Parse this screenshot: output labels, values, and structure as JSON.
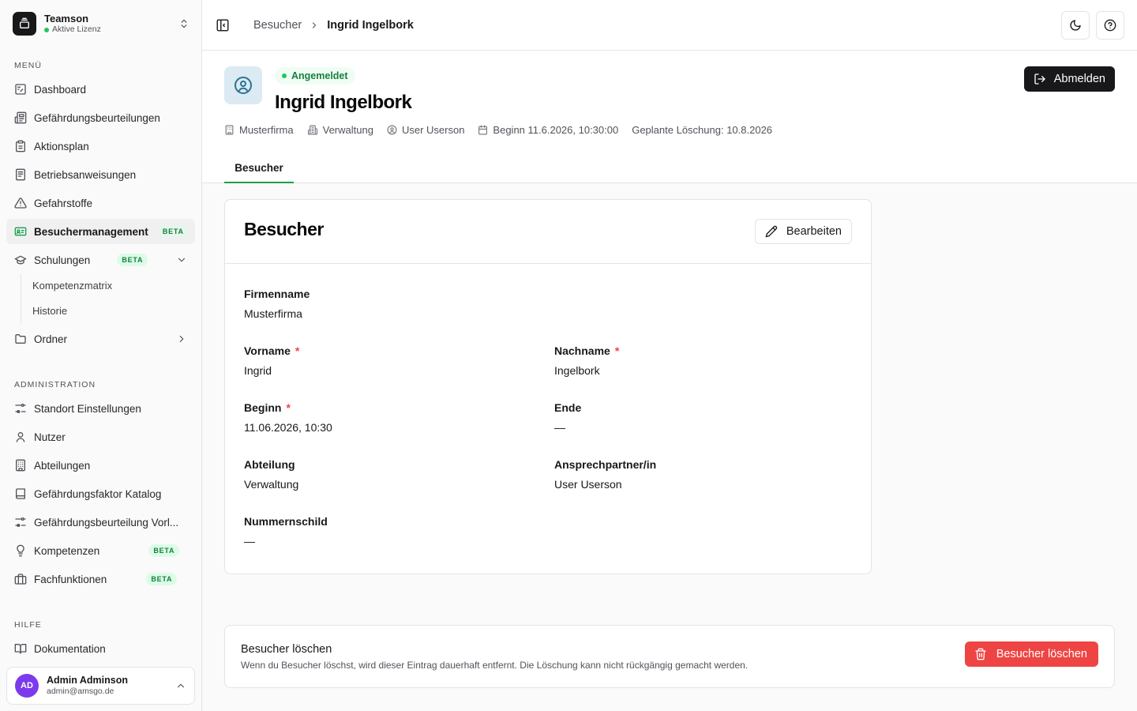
{
  "team": {
    "name": "Teamson",
    "license": "Aktive Lizenz"
  },
  "sidebar": {
    "menu_label": "MENÜ",
    "menu": [
      {
        "label": "Dashboard",
        "icon": "dashboard-icon"
      },
      {
        "label": "Gefährdungsbeurteilungen",
        "icon": "newspaper-icon"
      },
      {
        "label": "Aktionsplan",
        "icon": "clipboard-icon"
      },
      {
        "label": "Betriebsanweisungen",
        "icon": "file-text-icon"
      },
      {
        "label": "Gefahrstoffe",
        "icon": "warning-icon"
      },
      {
        "label": "Besuchermanagement",
        "icon": "id-card-icon",
        "badge": "BETA",
        "active": true
      },
      {
        "label": "Schulungen",
        "icon": "graduation-cap-icon",
        "badge": "BETA",
        "expanded": true
      },
      {
        "label": "Ordner",
        "icon": "folder-icon"
      }
    ],
    "sub_items": [
      "Kompetenzmatrix",
      "Historie"
    ],
    "admin_label": "ADMINISTRATION",
    "admin": [
      {
        "label": "Standort Einstellungen",
        "icon": "settings-sliders-icon"
      },
      {
        "label": "Nutzer",
        "icon": "user-icon"
      },
      {
        "label": "Abteilungen",
        "icon": "building-icon"
      },
      {
        "label": "Gefährdungsfaktor Katalog",
        "icon": "book-icon"
      },
      {
        "label": "Gefährdungsbeurteilung Vorl...",
        "icon": "settings-sliders-icon"
      },
      {
        "label": "Kompetenzen",
        "icon": "lightbulb-icon",
        "badge": "BETA"
      },
      {
        "label": "Fachfunktionen",
        "icon": "briefcase-icon",
        "badge": "BETA"
      }
    ],
    "help_label": "HILFE",
    "help": [
      {
        "label": "Dokumentation",
        "icon": "book-open-icon"
      }
    ]
  },
  "user": {
    "initials": "AD",
    "name": "Admin Adminson",
    "email": "admin@amsgo.de"
  },
  "breadcrumb": {
    "parent": "Besucher",
    "current": "Ingrid Ingelbork"
  },
  "header": {
    "status": "Angemeldet",
    "title": "Ingrid Ingelbork",
    "meta": {
      "company": "Musterfirma",
      "department": "Verwaltung",
      "contact": "User Userson",
      "begin": "Beginn 11.6.2026, 10:30:00",
      "deletion": "Geplante Löschung: 10.8.2026"
    },
    "logout_label": "Abmelden",
    "tab": "Besucher"
  },
  "card": {
    "title": "Besucher",
    "edit_label": "Bearbeiten",
    "fields": {
      "firmenname": {
        "label": "Firmenname",
        "value": "Musterfirma"
      },
      "vorname": {
        "label": "Vorname",
        "value": "Ingrid",
        "required": "*"
      },
      "nachname": {
        "label": "Nachname",
        "value": "Ingelbork",
        "required": "*"
      },
      "beginn": {
        "label": "Beginn",
        "value": "11.06.2026, 10:30",
        "required": "*"
      },
      "ende": {
        "label": "Ende",
        "value": "—"
      },
      "abteilung": {
        "label": "Abteilung",
        "value": "Verwaltung"
      },
      "ansprechpartner": {
        "label": "Ansprechpartner/in",
        "value": "User Userson"
      },
      "nummernschild": {
        "label": "Nummernschild",
        "value": "—"
      }
    }
  },
  "danger": {
    "title": "Besucher löschen",
    "text": "Wenn du Besucher löschst, wird dieser Eintrag dauerhaft entfernt. Die Löschung kann nicht rückgängig gemacht werden.",
    "button": "Besucher löschen"
  },
  "colors": {
    "accent": "#16a34a",
    "danger": "#ef4444",
    "primary": "#18181b",
    "avatar": "#7c3aed"
  }
}
